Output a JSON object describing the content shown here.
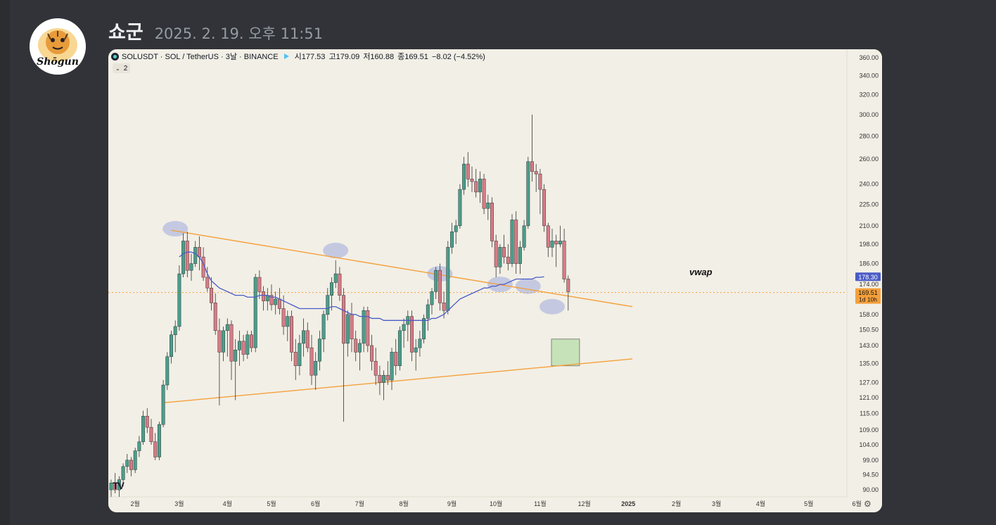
{
  "message": {
    "username": "쇼군",
    "timestamp": "2025. 2. 19. 오후 11:51",
    "avatar_text": "Shōgun"
  },
  "chart": {
    "symbol_line": "SOLUSDT · SOL / TetherUS · 3날 · BINANCE",
    "ohlc": {
      "open": "시177.53",
      "high": "고179.09",
      "low": "저160.88",
      "close": "종169.51",
      "change": "−8.02 (−4.52%)"
    },
    "indicator_badge": "2",
    "watermark": "TV",
    "annotation": "vwap",
    "vwap_label": "178.30",
    "price_label": "169.51",
    "countdown_label": "1d 10h",
    "colors": {
      "up": "#4a9e8b",
      "down": "#d97b86",
      "trendline": "#f5a03a",
      "vwap": "#4a5cc7",
      "zone": "#bfe0b0",
      "ellipse": "#aab4de",
      "background": "#f2efe6"
    }
  },
  "chart_data": {
    "type": "candlestick",
    "y_axis_labels": [
      "360.00",
      "340.00",
      "320.00",
      "300.00",
      "280.00",
      "260.00",
      "240.00",
      "225.00",
      "210.00",
      "198.00",
      "186.00",
      "174.00",
      "158.00",
      "150.50",
      "143.00",
      "135.00",
      "127.00",
      "121.00",
      "115.00",
      "109.00",
      "104.00",
      "99.00",
      "94.50",
      "90.00"
    ],
    "x_axis_labels": [
      "2월",
      "3월",
      "4월",
      "5월",
      "6월",
      "7월",
      "8월",
      "9월",
      "10월",
      "11월",
      "12월",
      "2025",
      "2월",
      "3월",
      "4월",
      "5월",
      "6월"
    ],
    "last_close": 169.51,
    "vwap": 178.3,
    "ylim": [
      88,
      365
    ],
    "scale": "log",
    "candles": [
      [
        90,
        93,
        88,
        92
      ],
      [
        92,
        95,
        89,
        90
      ],
      [
        90,
        94,
        88,
        93
      ],
      [
        93,
        98,
        91,
        97
      ],
      [
        97,
        101,
        95,
        99
      ],
      [
        99,
        100,
        94,
        96
      ],
      [
        96,
        103,
        95,
        102
      ],
      [
        102,
        107,
        100,
        105
      ],
      [
        105,
        116,
        104,
        114
      ],
      [
        114,
        117,
        108,
        110
      ],
      [
        110,
        113,
        104,
        105
      ],
      [
        105,
        108,
        99,
        100
      ],
      [
        100,
        112,
        99,
        111
      ],
      [
        111,
        128,
        110,
        126
      ],
      [
        126,
        140,
        124,
        138
      ],
      [
        138,
        150,
        135,
        148
      ],
      [
        148,
        155,
        140,
        152
      ],
      [
        152,
        185,
        150,
        180
      ],
      [
        180,
        205,
        178,
        200
      ],
      [
        200,
        206,
        178,
        182
      ],
      [
        182,
        192,
        176,
        186
      ],
      [
        186,
        200,
        184,
        196
      ],
      [
        196,
        203,
        182,
        190
      ],
      [
        190,
        196,
        176,
        178
      ],
      [
        178,
        184,
        170,
        172
      ],
      [
        172,
        178,
        160,
        164
      ],
      [
        164,
        169,
        148,
        150
      ],
      [
        150,
        156,
        118,
        140
      ],
      [
        140,
        152,
        136,
        150
      ],
      [
        150,
        156,
        138,
        153
      ],
      [
        153,
        155,
        128,
        136
      ],
      [
        136,
        146,
        120,
        141
      ],
      [
        141,
        150,
        134,
        145
      ],
      [
        145,
        148,
        136,
        139
      ],
      [
        139,
        150,
        137,
        148
      ],
      [
        148,
        150,
        140,
        142
      ],
      [
        142,
        180,
        140,
        178
      ],
      [
        178,
        182,
        166,
        170
      ],
      [
        170,
        173,
        160,
        165
      ],
      [
        165,
        172,
        160,
        168
      ],
      [
        168,
        174,
        160,
        163
      ],
      [
        163,
        170,
        158,
        166
      ],
      [
        166,
        172,
        158,
        161
      ],
      [
        161,
        168,
        148,
        152
      ],
      [
        152,
        160,
        145,
        157
      ],
      [
        157,
        160,
        136,
        140
      ],
      [
        140,
        146,
        128,
        134
      ],
      [
        134,
        148,
        130,
        144
      ],
      [
        144,
        156,
        138,
        150
      ],
      [
        150,
        154,
        140,
        142
      ],
      [
        142,
        148,
        126,
        130
      ],
      [
        130,
        140,
        124,
        136
      ],
      [
        136,
        150,
        132,
        146
      ],
      [
        146,
        160,
        140,
        158
      ],
      [
        158,
        172,
        155,
        168
      ],
      [
        168,
        178,
        160,
        175
      ],
      [
        175,
        188,
        172,
        180
      ],
      [
        180,
        184,
        165,
        168
      ],
      [
        168,
        172,
        112,
        144
      ],
      [
        144,
        160,
        138,
        158
      ],
      [
        158,
        164,
        140,
        146
      ],
      [
        146,
        150,
        136,
        140
      ],
      [
        140,
        146,
        132,
        144
      ],
      [
        144,
        162,
        140,
        160
      ],
      [
        160,
        162,
        140,
        143
      ],
      [
        143,
        148,
        132,
        136
      ],
      [
        136,
        142,
        126,
        130
      ],
      [
        130,
        134,
        122,
        127
      ],
      [
        127,
        132,
        120,
        130
      ],
      [
        130,
        136,
        126,
        128
      ],
      [
        128,
        142,
        124,
        140
      ],
      [
        140,
        146,
        130,
        134
      ],
      [
        134,
        152,
        132,
        150
      ],
      [
        150,
        156,
        142,
        153
      ],
      [
        153,
        160,
        145,
        157
      ],
      [
        157,
        160,
        136,
        140
      ],
      [
        140,
        146,
        132,
        142
      ],
      [
        142,
        150,
        138,
        146
      ],
      [
        146,
        158,
        144,
        156
      ],
      [
        156,
        166,
        150,
        163
      ],
      [
        163,
        172,
        158,
        170
      ],
      [
        170,
        184,
        166,
        182
      ],
      [
        182,
        186,
        160,
        164
      ],
      [
        164,
        170,
        156,
        160
      ],
      [
        160,
        200,
        158,
        196
      ],
      [
        196,
        212,
        192,
        206
      ],
      [
        206,
        214,
        198,
        210
      ],
      [
        210,
        240,
        208,
        236
      ],
      [
        236,
        262,
        232,
        256
      ],
      [
        256,
        266,
        238,
        244
      ],
      [
        244,
        254,
        234,
        242
      ],
      [
        242,
        252,
        230,
        234
      ],
      [
        234,
        250,
        226,
        244
      ],
      [
        244,
        248,
        218,
        222
      ],
      [
        222,
        232,
        214,
        226
      ],
      [
        226,
        230,
        196,
        200
      ],
      [
        200,
        204,
        178,
        184
      ],
      [
        184,
        198,
        180,
        196
      ],
      [
        196,
        204,
        186,
        190
      ],
      [
        190,
        198,
        182,
        186
      ],
      [
        186,
        218,
        184,
        214
      ],
      [
        214,
        220,
        180,
        186
      ],
      [
        186,
        200,
        180,
        196
      ],
      [
        196,
        214,
        194,
        210
      ],
      [
        210,
        262,
        208,
        258
      ],
      [
        258,
        300,
        242,
        250
      ],
      [
        250,
        256,
        234,
        248
      ],
      [
        248,
        252,
        218,
        236
      ],
      [
        236,
        240,
        206,
        210
      ],
      [
        210,
        212,
        190,
        196
      ],
      [
        196,
        208,
        190,
        200
      ],
      [
        200,
        204,
        184,
        198
      ],
      [
        198,
        210,
        196,
        200
      ],
      [
        200,
        208,
        175,
        177
      ],
      [
        177,
        179,
        160,
        170
      ]
    ],
    "vwap_series": [
      [
        17,
        190
      ],
      [
        18,
        192
      ],
      [
        19,
        193
      ],
      [
        20,
        193
      ],
      [
        21,
        192
      ],
      [
        22,
        190
      ],
      [
        23,
        186
      ],
      [
        24,
        180
      ],
      [
        25,
        176
      ],
      [
        26,
        174
      ],
      [
        27,
        172
      ],
      [
        28,
        171
      ],
      [
        29,
        170
      ],
      [
        30,
        169
      ],
      [
        31,
        168
      ],
      [
        32,
        168
      ],
      [
        33,
        168
      ],
      [
        34,
        167
      ],
      [
        35,
        167
      ],
      [
        36,
        167
      ],
      [
        37,
        168
      ],
      [
        38,
        168
      ],
      [
        39,
        168
      ],
      [
        40,
        167
      ],
      [
        41,
        167
      ],
      [
        42,
        166
      ],
      [
        43,
        165
      ],
      [
        44,
        164
      ],
      [
        45,
        163
      ],
      [
        46,
        162
      ],
      [
        47,
        161
      ],
      [
        48,
        161
      ],
      [
        49,
        161
      ],
      [
        50,
        161
      ],
      [
        51,
        161
      ],
      [
        52,
        161
      ],
      [
        53,
        161
      ],
      [
        54,
        161
      ],
      [
        55,
        162
      ],
      [
        56,
        162
      ],
      [
        57,
        161
      ],
      [
        58,
        160
      ],
      [
        59,
        159
      ],
      [
        60,
        158
      ],
      [
        61,
        158
      ],
      [
        62,
        157
      ],
      [
        63,
        157
      ],
      [
        64,
        157
      ],
      [
        65,
        156
      ],
      [
        66,
        156
      ],
      [
        67,
        156
      ],
      [
        68,
        155
      ],
      [
        69,
        155
      ],
      [
        70,
        155
      ],
      [
        71,
        155
      ],
      [
        72,
        155
      ],
      [
        73,
        155
      ],
      [
        74,
        155
      ],
      [
        75,
        155
      ],
      [
        76,
        155
      ],
      [
        77,
        155
      ],
      [
        78,
        155
      ],
      [
        79,
        155
      ],
      [
        80,
        156
      ],
      [
        81,
        156
      ],
      [
        82,
        157
      ],
      [
        83,
        158
      ],
      [
        84,
        160
      ],
      [
        85,
        162
      ],
      [
        86,
        164
      ],
      [
        87,
        166
      ],
      [
        88,
        167
      ],
      [
        89,
        168
      ],
      [
        90,
        169
      ],
      [
        91,
        170
      ],
      [
        92,
        171
      ],
      [
        93,
        172
      ],
      [
        94,
        172
      ],
      [
        95,
        173
      ],
      [
        96,
        173
      ],
      [
        97,
        174
      ],
      [
        98,
        174
      ],
      [
        99,
        175
      ],
      [
        100,
        176
      ],
      [
        101,
        177
      ],
      [
        102,
        177
      ],
      [
        103,
        177
      ],
      [
        104,
        177
      ],
      [
        105,
        177
      ],
      [
        106,
        178
      ],
      [
        107,
        178
      ],
      [
        108,
        178.3
      ]
    ],
    "trendlines": [
      {
        "from": [
          15,
          207
        ],
        "to": [
          130,
          162
        ]
      },
      {
        "from": [
          13,
          119
        ],
        "to": [
          130,
          137
        ]
      }
    ],
    "zone": {
      "from_index": 110,
      "to_index": 117,
      "top": 146,
      "bottom": 134
    },
    "touch_ellipses": [
      [
        16,
        208
      ],
      [
        56,
        194
      ],
      [
        82,
        180
      ],
      [
        97,
        174
      ],
      [
        104,
        173
      ],
      [
        110,
        162
      ]
    ]
  }
}
